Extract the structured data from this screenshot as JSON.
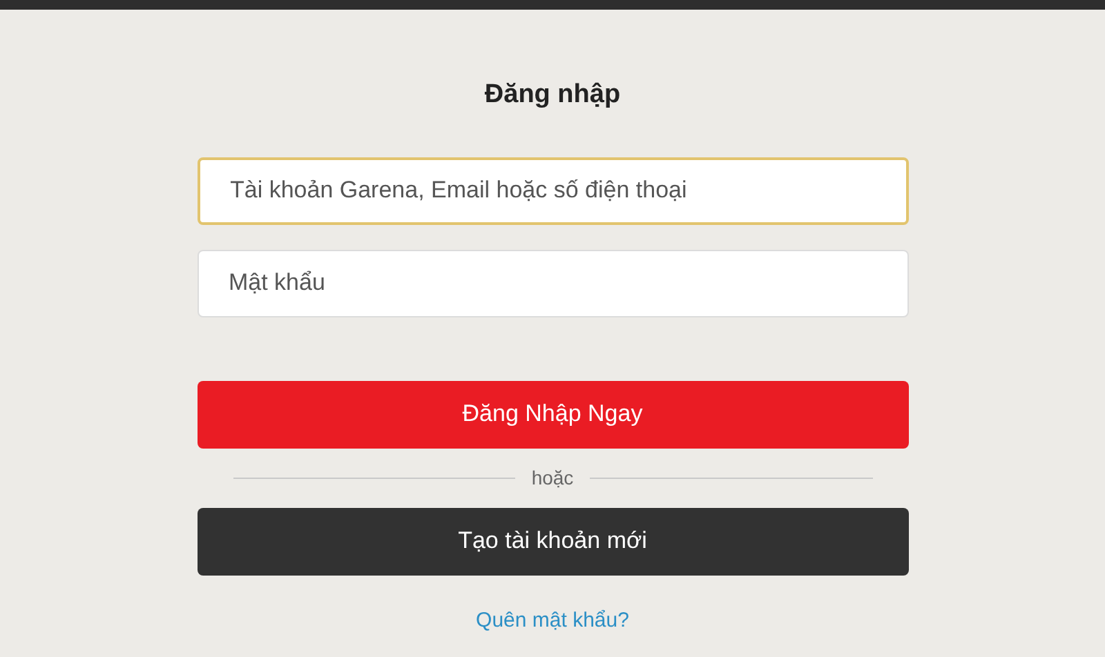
{
  "title": "Đăng nhập",
  "fields": [
    {
      "placeholder": "Tài khoản Garena, Email hoặc số điện thoại",
      "focused": true
    },
    {
      "placeholder": "Mật khẩu",
      "focused": false
    }
  ],
  "login_button": "Đăng Nhập Ngay",
  "divider_text": "hoặc",
  "register_button": "Tạo tài khoản mới",
  "forgot_link": "Quên mật khẩu?"
}
